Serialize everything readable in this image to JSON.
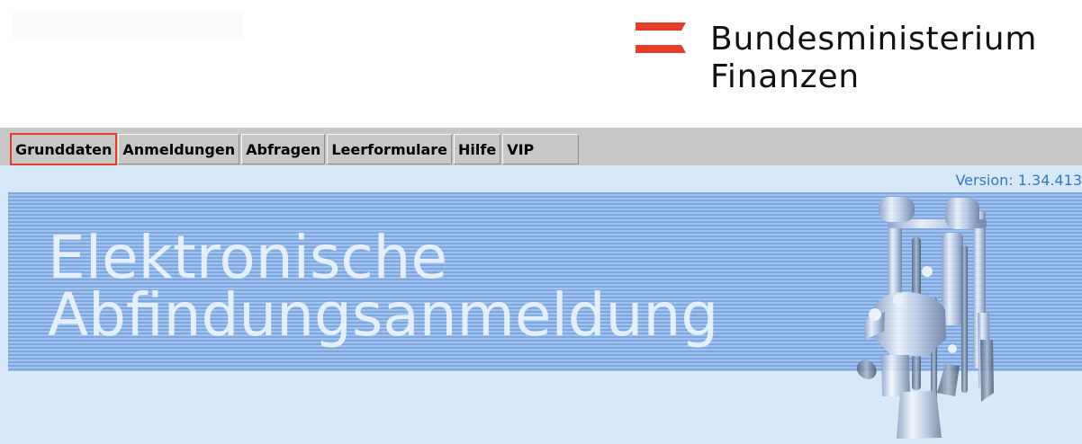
{
  "header": {
    "logo_text": {
      "line1": "Bundesministerium",
      "line2": "Finanzen"
    }
  },
  "menu": {
    "items": [
      {
        "label": "Grunddaten",
        "selected": true
      },
      {
        "label": "Anmeldungen",
        "selected": false
      },
      {
        "label": "Abfragen",
        "selected": false
      },
      {
        "label": "Leerformulare",
        "selected": false
      },
      {
        "label": "Hilfe",
        "selected": false
      },
      {
        "label": "VIP",
        "selected": false
      }
    ]
  },
  "main": {
    "version": "Version: 1.34.413",
    "banner_title": {
      "line1": "Elektronische",
      "line2": "Abfindungsanmeldung"
    }
  },
  "icons": {
    "ministry_logo_mark": "austrian-flag-icon",
    "banner_illustration": "distillery-apparatus-icon"
  },
  "colors": {
    "flag_red": "#e53d2a",
    "menu_gray": "#c7c7c7",
    "version_blue": "#2f78c7",
    "banner_blue": "#80a7dd",
    "content_background": "#d7e8f8"
  }
}
